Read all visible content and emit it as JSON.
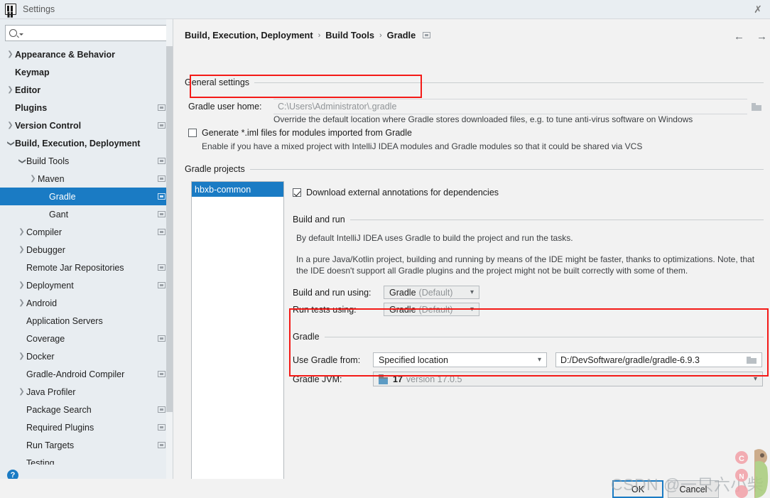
{
  "window": {
    "title": "Settings",
    "logo_icon": "intellij-idea-logo-icon",
    "close_icon": "close-icon"
  },
  "sidebar": {
    "search": {
      "value": "",
      "placeholder": "",
      "icon": "search-icon"
    },
    "items": [
      {
        "label": "Appearance & Behavior",
        "indent": 0,
        "arrow": "right",
        "bold": true,
        "badge": false,
        "selected": false
      },
      {
        "label": "Keymap",
        "indent": 0,
        "arrow": "none",
        "bold": true,
        "badge": false,
        "selected": false
      },
      {
        "label": "Editor",
        "indent": 0,
        "arrow": "right",
        "bold": true,
        "badge": false,
        "selected": false
      },
      {
        "label": "Plugins",
        "indent": 0,
        "arrow": "none",
        "bold": true,
        "badge": true,
        "selected": false
      },
      {
        "label": "Version Control",
        "indent": 0,
        "arrow": "right",
        "bold": true,
        "badge": true,
        "selected": false
      },
      {
        "label": "Build, Execution, Deployment",
        "indent": 0,
        "arrow": "down",
        "bold": true,
        "badge": false,
        "selected": false
      },
      {
        "label": "Build Tools",
        "indent": 1,
        "arrow": "down",
        "bold": false,
        "badge": true,
        "selected": false
      },
      {
        "label": "Maven",
        "indent": 2,
        "arrow": "right",
        "bold": false,
        "badge": true,
        "selected": false
      },
      {
        "label": "Gradle",
        "indent": 3,
        "arrow": "none",
        "bold": false,
        "badge": true,
        "selected": true
      },
      {
        "label": "Gant",
        "indent": 3,
        "arrow": "none",
        "bold": false,
        "badge": true,
        "selected": false
      },
      {
        "label": "Compiler",
        "indent": 1,
        "arrow": "right",
        "bold": false,
        "badge": true,
        "selected": false
      },
      {
        "label": "Debugger",
        "indent": 1,
        "arrow": "right",
        "bold": false,
        "badge": false,
        "selected": false
      },
      {
        "label": "Remote Jar Repositories",
        "indent": 1,
        "arrow": "none",
        "bold": false,
        "badge": true,
        "selected": false
      },
      {
        "label": "Deployment",
        "indent": 1,
        "arrow": "right",
        "bold": false,
        "badge": true,
        "selected": false
      },
      {
        "label": "Android",
        "indent": 1,
        "arrow": "right",
        "bold": false,
        "badge": false,
        "selected": false
      },
      {
        "label": "Application Servers",
        "indent": 1,
        "arrow": "none",
        "bold": false,
        "badge": false,
        "selected": false
      },
      {
        "label": "Coverage",
        "indent": 1,
        "arrow": "none",
        "bold": false,
        "badge": true,
        "selected": false
      },
      {
        "label": "Docker",
        "indent": 1,
        "arrow": "right",
        "bold": false,
        "badge": false,
        "selected": false
      },
      {
        "label": "Gradle-Android Compiler",
        "indent": 1,
        "arrow": "none",
        "bold": false,
        "badge": true,
        "selected": false
      },
      {
        "label": "Java Profiler",
        "indent": 1,
        "arrow": "right",
        "bold": false,
        "badge": false,
        "selected": false
      },
      {
        "label": "Package Search",
        "indent": 1,
        "arrow": "none",
        "bold": false,
        "badge": true,
        "selected": false
      },
      {
        "label": "Required Plugins",
        "indent": 1,
        "arrow": "none",
        "bold": false,
        "badge": true,
        "selected": false
      },
      {
        "label": "Run Targets",
        "indent": 1,
        "arrow": "none",
        "bold": false,
        "badge": true,
        "selected": false
      },
      {
        "label": "Testing",
        "indent": 1,
        "arrow": "none",
        "bold": false,
        "badge": false,
        "selected": false
      }
    ],
    "help_icon": "help-question-icon",
    "help_label": "?"
  },
  "header": {
    "crumb1": "Build, Execution, Deployment",
    "sep1": "›",
    "crumb2": "Build Tools",
    "sep2": "›",
    "crumb3": "Gradle",
    "badge_icon": "project-scope-badge-icon",
    "back_icon": "arrow-left-icon",
    "forward_icon": "arrow-right-icon",
    "back_glyph": "←",
    "forward_glyph": "→"
  },
  "general": {
    "group_title": "General settings",
    "user_home_label": "Gradle user home:",
    "user_home_value": "",
    "user_home_placeholder": "C:\\Users\\Administrator\\.gradle",
    "user_home_browse_icon": "folder-browse-icon",
    "user_home_hint": "Override the default location where Gradle stores downloaded files, e.g. to tune anti-virus software on Windows",
    "generate_iml_label": "Generate *.iml files for modules imported from Gradle",
    "generate_iml_checked": false,
    "generate_iml_hint": "Enable if you have a mixed project with IntelliJ IDEA modules and Gradle modules so that it could be shared via VCS"
  },
  "projects": {
    "group_title": "Gradle projects",
    "items": [
      "hbxb-common"
    ],
    "selected_index": 0
  },
  "options": {
    "download_annotations_label": "Download external annotations for dependencies",
    "download_annotations_checked": true
  },
  "build_and_run": {
    "group_title": "Build and run",
    "paragraph1": "By default IntelliJ IDEA uses Gradle to build the project and run the tasks.",
    "paragraph2": "In a pure Java/Kotlin project, building and running by means of the IDE might be faster, thanks to optimizations. Note, that the IDE doesn't support all Gradle plugins and the project might not be built correctly with some of them.",
    "build_using_label": "Build and run using:",
    "build_using_value": "Gradle",
    "build_using_suffix": "(Default)",
    "run_tests_label": "Run tests using:",
    "run_tests_value": "Gradle",
    "run_tests_suffix": "(Default)",
    "chevron_icon": "chevron-down-icon"
  },
  "gradle_section": {
    "group_title": "Gradle",
    "use_gradle_from_label": "Use Gradle from:",
    "use_gradle_from_value": "Specified location",
    "gradle_path_value": "D:/DevSoftware/gradle/gradle-6.9.3",
    "gradle_path_browse_icon": "folder-browse-icon",
    "gradle_jvm_label": "Gradle JVM:",
    "gradle_jvm_icon": "jdk-folder-icon",
    "gradle_jvm_value": "17",
    "gradle_jvm_version": "version 17.0.5",
    "chevron_icon": "chevron-down-icon"
  },
  "footer": {
    "ok_label": "OK",
    "cancel_label": "Cancel"
  },
  "watermark": {
    "text": "CSDN @一只六小柴",
    "mascot_icon": "csdn-mascot-icon"
  },
  "colors": {
    "accent": "#1a7bc4",
    "highlight_red": "#f41a17",
    "sidebar_bg": "#e8edf1",
    "panel_bg": "#f2f2f2",
    "titlebar_bg": "#e9eef2"
  }
}
